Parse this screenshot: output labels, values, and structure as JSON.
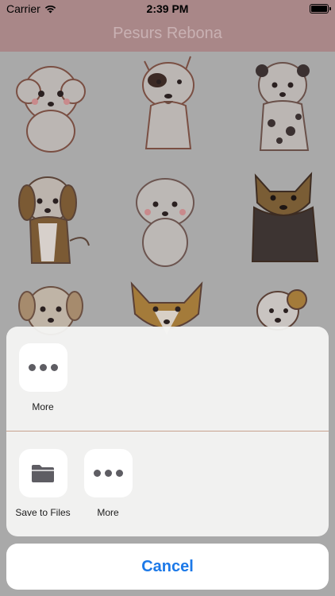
{
  "status_bar": {
    "carrier": "Carrier",
    "time": "2:39 PM",
    "wifi_icon": "wifi-icon",
    "battery_icon": "battery-icon"
  },
  "nav": {
    "title": "Pesurs Rebona"
  },
  "colors": {
    "nav_background": "#a98788",
    "dim_background": "#a9a9a9",
    "accent": "#1c79e8"
  },
  "share_sheet": {
    "row1": [
      {
        "icon": "more-icon",
        "label": "More"
      }
    ],
    "row2": [
      {
        "icon": "folder-icon",
        "label": "Save to Files"
      },
      {
        "icon": "more-icon",
        "label": "More"
      }
    ]
  },
  "cancel_label": "Cancel"
}
